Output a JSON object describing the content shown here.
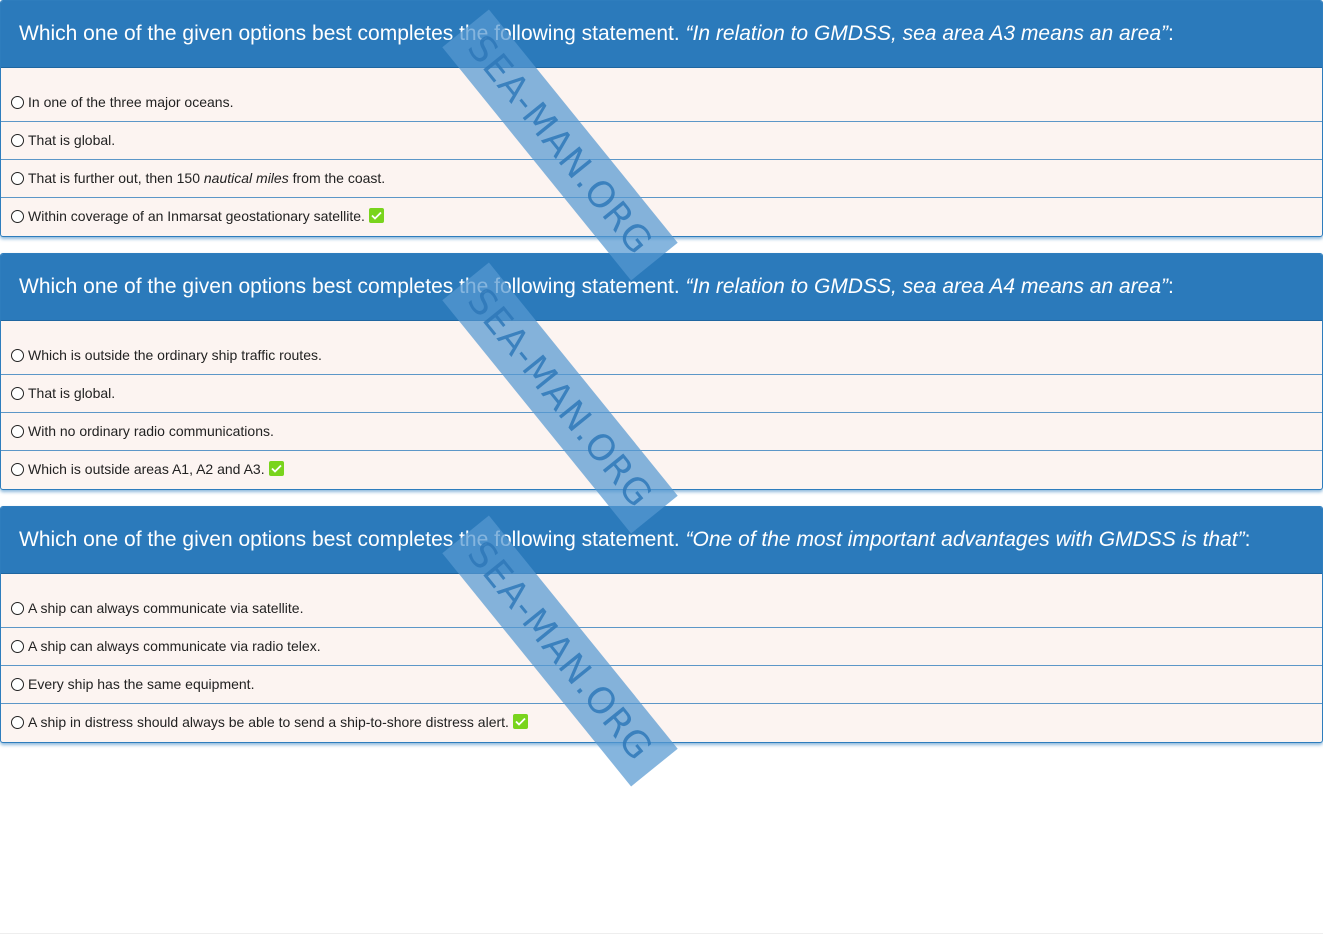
{
  "questions": [
    {
      "prefix": "Which one of the given options best completes the following statement. ",
      "quote": "“In relation to GMDSS, sea area A3 means an area”",
      "suffix": ":",
      "options": [
        {
          "text": "In one of the three major oceans.",
          "correct": false
        },
        {
          "text": "That is global.",
          "correct": false
        },
        {
          "text_a": "That is further out, then 150 ",
          "text_em": "nautical miles",
          "text_b": " from the coast.",
          "correct": false
        },
        {
          "text": "Within coverage of an Inmarsat geostationary satellite.",
          "correct": true
        }
      ]
    },
    {
      "prefix": "Which one of the given options best completes the following statement. ",
      "quote": "“In relation to GMDSS, sea area A4 means an area”",
      "suffix": ":",
      "options": [
        {
          "text": "Which is outside the ordinary ship traffic routes.",
          "correct": false
        },
        {
          "text": "That is global.",
          "correct": false
        },
        {
          "text": "With no ordinary radio communications.",
          "correct": false
        },
        {
          "text": "Which is outside areas A1, A2 and A3.",
          "correct": true
        }
      ]
    },
    {
      "prefix": "Which one of the given options best completes the following statement. ",
      "quote": "“One of the most important advantages with GMDSS is that”",
      "suffix": ":",
      "options": [
        {
          "text": "A ship can always communicate via satellite.",
          "correct": false
        },
        {
          "text": "A ship can always communicate via radio telex.",
          "correct": false
        },
        {
          "text": "Every ship has the same equipment.",
          "correct": false
        },
        {
          "text": "A ship in distress should always be able to send a ship-to-shore distress alert.",
          "correct": true
        }
      ]
    }
  ],
  "watermark": "SEA-MAN.ORG",
  "colors": {
    "header": "#2b7abb",
    "card_bg": "#fcf4f1",
    "check": "#79d41d"
  },
  "icons": {
    "radio": "radio-circle-icon",
    "check": "checkmark-icon"
  }
}
